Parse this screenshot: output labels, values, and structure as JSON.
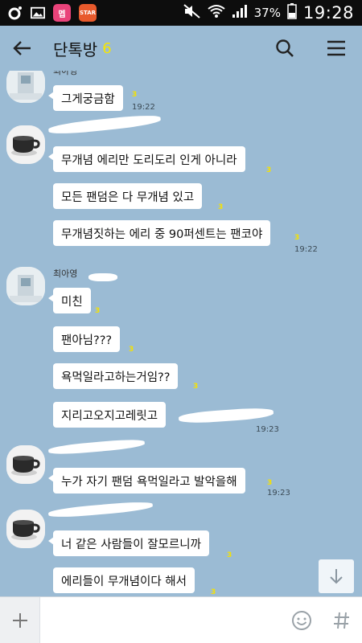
{
  "status_bar": {
    "battery": "37%",
    "time": "19:28",
    "app_icon_1": "멥",
    "app_icon_2": "STAR"
  },
  "header": {
    "title": "단톡방",
    "member_count": "6"
  },
  "messages": [
    {
      "text": "그게궁금함",
      "unread": "3",
      "time": "19:22"
    },
    {
      "text": "무개념 에리만 도리도리 인게 아니라",
      "unread": "3"
    },
    {
      "text": "모든 팬덤은 다 무개념 있고",
      "unread": "3"
    },
    {
      "text": "무개념짓하는 에리 중 90퍼센트는 팬코야",
      "unread": "3",
      "time": "19:22"
    },
    {
      "text": "미친",
      "unread": "3"
    },
    {
      "text": "팬아님???",
      "unread": "3"
    },
    {
      "text": "욕먹일라고하는거임??",
      "unread": "3"
    },
    {
      "text": "지리고오지고레릿고",
      "time": "19:23"
    },
    {
      "text": "누가 자기 팬덤 욕먹일라고 발악을해",
      "unread": "3",
      "time": "19:23"
    },
    {
      "text": "너 같은 사람들이 잘모르니까",
      "unread": "3"
    },
    {
      "text": "에리들이 무개념이다 해서",
      "unread": "3"
    }
  ],
  "names": {
    "top_partial": "최아영",
    "sender_2": "최아영"
  },
  "input": {
    "placeholder": ""
  },
  "icons": {
    "back": "arrow-left",
    "search": "magnifier",
    "menu": "hamburger",
    "plus": "plus",
    "emoji": "smiley",
    "hash": "hash",
    "scroll_down": "arrow-down"
  },
  "colors": {
    "background": "#9bbbd4",
    "unread": "#f6e200",
    "member_count": "#f7e600"
  }
}
